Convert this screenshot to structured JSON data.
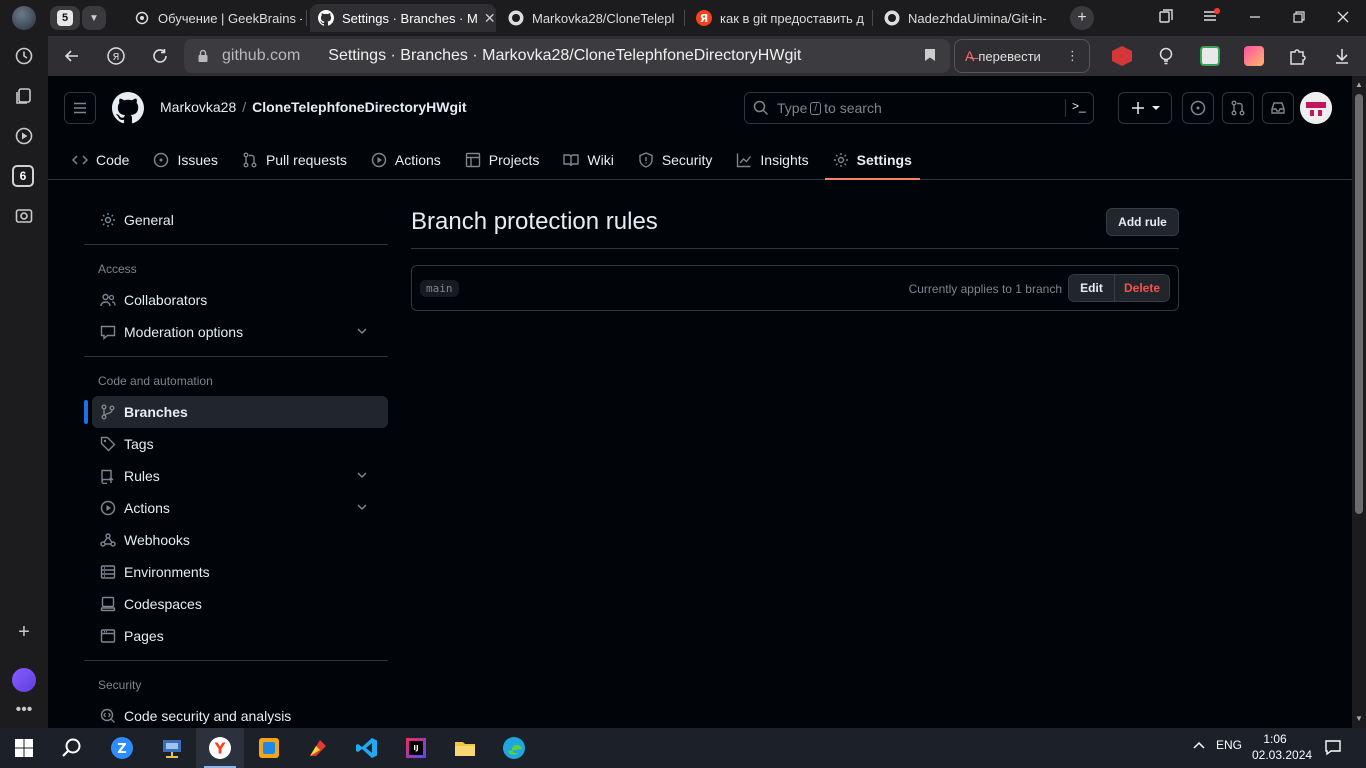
{
  "browser": {
    "tab_count": "5",
    "tabs": [
      {
        "label": "Обучение | GeekBrains -",
        "favicon": "geekbrains-icon"
      },
      {
        "label": "Settings · Branches · M",
        "favicon": "github-icon",
        "active": true
      },
      {
        "label": "Markovka28/CloneTelepl",
        "favicon": "github-icon"
      },
      {
        "label": "как в git предоставить д",
        "favicon": "yandex-icon"
      },
      {
        "label": "NadezhdaUimina/Git-in-",
        "favicon": "github-icon"
      }
    ],
    "url_domain": "github.com",
    "url_title": "Settings · Branches · Markovka28/CloneTelephfoneDirectoryHWgit",
    "translate_label": "перевести",
    "rail_badge": "6"
  },
  "github": {
    "owner": "Markovka28",
    "repo": "CloneTelephfoneDirectoryHWgit",
    "breadcrumb_sep": "/",
    "search": {
      "prefix": "Type",
      "key": "/",
      "suffix": "to search"
    },
    "repo_tabs": [
      {
        "label": "Code",
        "icon": "code-icon"
      },
      {
        "label": "Issues",
        "icon": "issue-icon"
      },
      {
        "label": "Pull requests",
        "icon": "pull-request-icon"
      },
      {
        "label": "Actions",
        "icon": "play-icon"
      },
      {
        "label": "Projects",
        "icon": "table-icon"
      },
      {
        "label": "Wiki",
        "icon": "book-icon"
      },
      {
        "label": "Security",
        "icon": "shield-icon"
      },
      {
        "label": "Insights",
        "icon": "graph-icon"
      },
      {
        "label": "Settings",
        "icon": "gear-icon",
        "selected": true
      }
    ],
    "sidebar": {
      "general": "General",
      "access_heading": "Access",
      "collaborators": "Collaborators",
      "moderation": "Moderation options",
      "automation_heading": "Code and automation",
      "branches": "Branches",
      "tags": "Tags",
      "rules": "Rules",
      "actions": "Actions",
      "webhooks": "Webhooks",
      "environments": "Environments",
      "codespaces": "Codespaces",
      "pages": "Pages",
      "security_heading": "Security",
      "code_security": "Code security and analysis"
    },
    "content": {
      "title": "Branch protection rules",
      "add_rule": "Add rule",
      "rule": {
        "branch": "main",
        "applies": "Currently applies to 1 branch",
        "edit": "Edit",
        "delete": "Delete"
      }
    }
  },
  "taskbar": {
    "lang": "ENG",
    "time": "1:06",
    "date": "02.03.2024"
  }
}
